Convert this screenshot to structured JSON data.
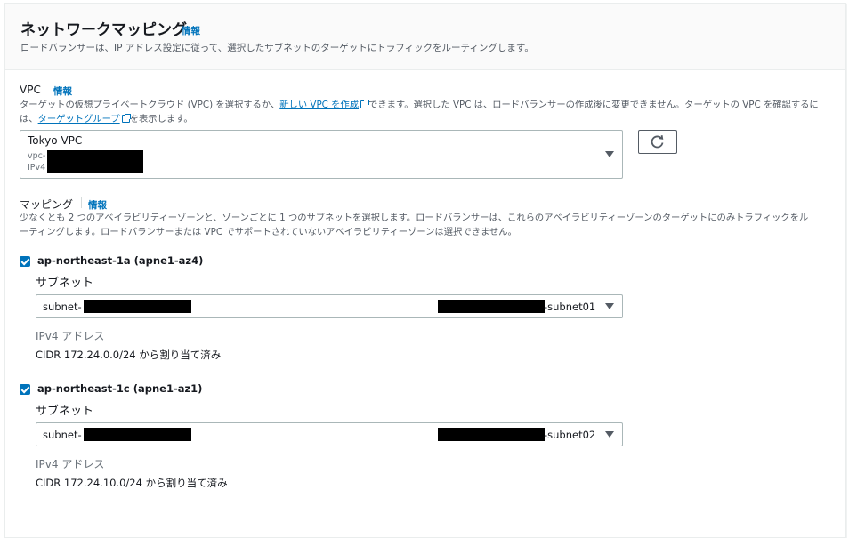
{
  "header": {
    "title": "ネットワークマッピング",
    "info": "情報",
    "description": "ロードバランサーは、IP アドレス設定に従って、選択したサブネットのターゲットにトラフィックをルーティングします。"
  },
  "vpc": {
    "label": "VPC",
    "info": "情報",
    "desc_part1": "ターゲットの仮想プライベートクラウド (VPC) を選択するか、",
    "create_link": "新しい VPC を作成",
    "desc_part2": "できます。選択した VPC は、ロードバランサーの作成後に変更できません。ターゲットの VPC を確認するに",
    "desc_part3": "は、",
    "target_group_link": "ターゲットグループ",
    "desc_part4": "を表示します。",
    "selected_name": "Tokyo-VPC",
    "id_prefix": "vpc-",
    "cidr_prefix": "IPv4"
  },
  "refresh_icon": "refresh-icon",
  "mapping": {
    "label": "マッピング",
    "info": "情報",
    "desc_line1": "少なくとも 2 つのアベイラビリティーゾーンと、ゾーンごとに 1 つのサブネットを選択します。ロードバランサーは、これらのアベイラビリティーゾーンのターゲットにのみトラフィックをル",
    "desc_line2": "ーティングします。ロードバランサーまたは VPC でサポートされていないアベイラビリティーゾーンは選択できません。",
    "zones": [
      {
        "name": "ap-northeast-1a (apne1-az4)",
        "checked": true,
        "subnet_label": "サブネット",
        "subnet_prefix": "subnet-",
        "subnet_suffix": "-subnet01",
        "ipv4_label": "IPv4 アドレス",
        "cidr": "CIDR 172.24.0.0/24 から割り当て済み"
      },
      {
        "name": "ap-northeast-1c (apne1-az1)",
        "checked": true,
        "subnet_label": "サブネット",
        "subnet_prefix": "subnet-",
        "subnet_suffix": "-subnet02",
        "ipv4_label": "IPv4 アドレス",
        "cidr": "CIDR 172.24.10.0/24 から割り当て済み"
      }
    ]
  },
  "colors": {
    "link": "#0073bb",
    "checkbox": "#0073bb",
    "text": "#16191f",
    "muted": "#545b64"
  }
}
